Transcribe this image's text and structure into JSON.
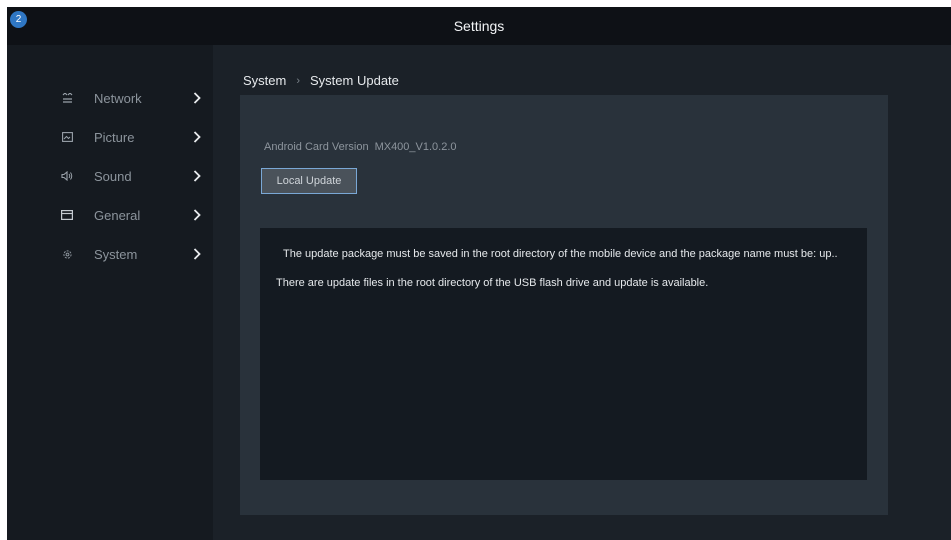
{
  "header": {
    "title": "Settings",
    "badge": "2"
  },
  "sidebar": {
    "items": [
      {
        "label": "Network",
        "icon": "network-icon"
      },
      {
        "label": "Picture",
        "icon": "picture-icon"
      },
      {
        "label": "Sound",
        "icon": "sound-icon"
      },
      {
        "label": "General",
        "icon": "general-icon"
      },
      {
        "label": "System",
        "icon": "system-icon"
      }
    ]
  },
  "breadcrumb": {
    "parent": "System",
    "separator": "›",
    "current": "System Update"
  },
  "main": {
    "version_label": "Android Card Version",
    "version_value": "MX400_V1.0.2.0",
    "local_update_label": "Local Update",
    "info_line1": "The update package must be saved in the root directory of the mobile device and the package name must be: up..",
    "info_line2": "There are update files in the root directory of the USB flash drive and update is available."
  },
  "colors": {
    "accent": "#2f77c4",
    "focus_border": "#7aa8d6",
    "background": "#1b2128",
    "panel": "#29323b"
  }
}
